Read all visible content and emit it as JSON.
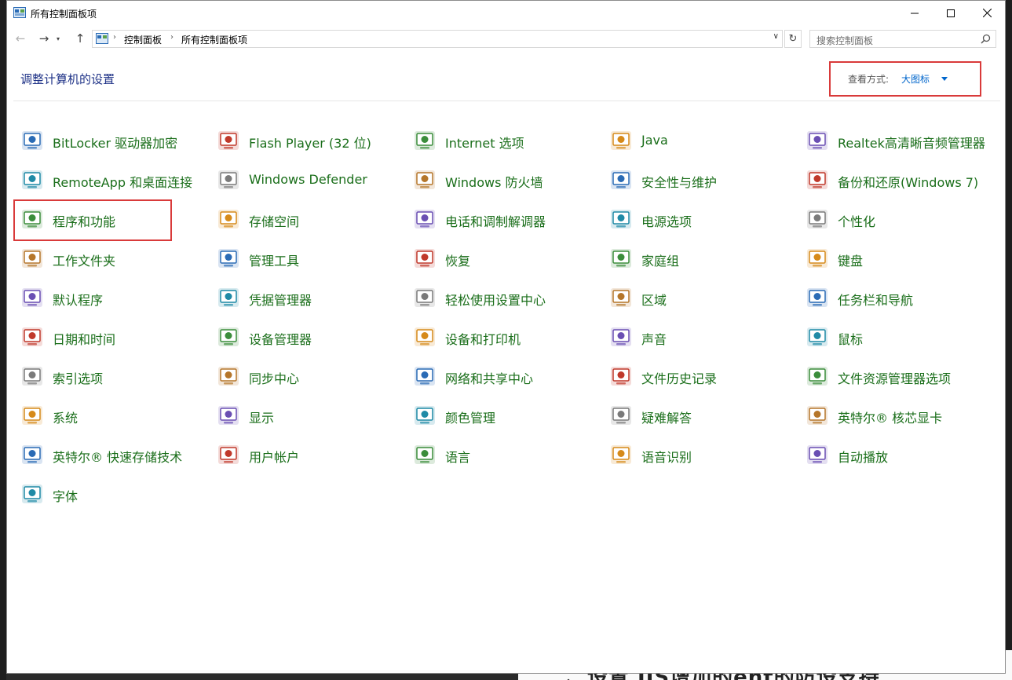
{
  "window": {
    "title": "所有控制面板项"
  },
  "address": {
    "crumbs": [
      "控制面板",
      "所有控制面板项"
    ]
  },
  "search": {
    "placeholder": "搜索控制面板"
  },
  "header": {
    "title": "调整计算机的设置",
    "view_by_label": "查看方式:",
    "view_by_value": "大图标"
  },
  "background_text": "二、设置 IIS增加的ent的防设支持",
  "items": [
    {
      "label": "BitLocker 驱动器加密",
      "icon": "bitlocker-icon"
    },
    {
      "label": "Flash Player (32 位)",
      "icon": "flash-player-icon"
    },
    {
      "label": "Internet 选项",
      "icon": "internet-options-icon"
    },
    {
      "label": "Java",
      "icon": "java-icon"
    },
    {
      "label": "Realtek高清晰音频管理器",
      "icon": "realtek-audio-icon"
    },
    {
      "label": "RemoteApp 和桌面连接",
      "icon": "remoteapp-icon"
    },
    {
      "label": "Windows Defender",
      "icon": "windows-defender-icon"
    },
    {
      "label": "Windows 防火墙",
      "icon": "firewall-icon"
    },
    {
      "label": "安全性与维护",
      "icon": "security-flag-icon"
    },
    {
      "label": "备份和还原(Windows 7)",
      "icon": "backup-restore-icon"
    },
    {
      "label": "程序和功能",
      "icon": "programs-features-icon"
    },
    {
      "label": "存储空间",
      "icon": "storage-spaces-icon"
    },
    {
      "label": "电话和调制解调器",
      "icon": "phone-modem-icon"
    },
    {
      "label": "电源选项",
      "icon": "power-options-icon"
    },
    {
      "label": "个性化",
      "icon": "personalization-icon"
    },
    {
      "label": "工作文件夹",
      "icon": "work-folders-icon"
    },
    {
      "label": "管理工具",
      "icon": "admin-tools-icon"
    },
    {
      "label": "恢复",
      "icon": "recovery-icon"
    },
    {
      "label": "家庭组",
      "icon": "homegroup-icon"
    },
    {
      "label": "键盘",
      "icon": "keyboard-icon"
    },
    {
      "label": "默认程序",
      "icon": "default-programs-icon"
    },
    {
      "label": "凭据管理器",
      "icon": "credential-manager-icon"
    },
    {
      "label": "轻松使用设置中心",
      "icon": "ease-of-access-icon"
    },
    {
      "label": "区域",
      "icon": "region-globe-icon"
    },
    {
      "label": "任务栏和导航",
      "icon": "taskbar-navigation-icon"
    },
    {
      "label": "日期和时间",
      "icon": "date-time-icon"
    },
    {
      "label": "设备管理器",
      "icon": "device-manager-icon"
    },
    {
      "label": "设备和打印机",
      "icon": "devices-printers-icon"
    },
    {
      "label": "声音",
      "icon": "sound-speaker-icon"
    },
    {
      "label": "鼠标",
      "icon": "mouse-icon"
    },
    {
      "label": "索引选项",
      "icon": "indexing-options-icon"
    },
    {
      "label": "同步中心",
      "icon": "sync-center-icon"
    },
    {
      "label": "网络和共享中心",
      "icon": "network-sharing-icon"
    },
    {
      "label": "文件历史记录",
      "icon": "file-history-icon"
    },
    {
      "label": "文件资源管理器选项",
      "icon": "explorer-options-icon"
    },
    {
      "label": "系统",
      "icon": "system-icon"
    },
    {
      "label": "显示",
      "icon": "display-monitor-icon"
    },
    {
      "label": "颜色管理",
      "icon": "color-management-icon"
    },
    {
      "label": "疑难解答",
      "icon": "troubleshooting-icon"
    },
    {
      "label": "英特尔® 核芯显卡",
      "icon": "intel-graphics-icon"
    },
    {
      "label": "英特尔® 快速存储技术",
      "icon": "intel-rapid-storage-icon"
    },
    {
      "label": "用户帐户",
      "icon": "user-accounts-icon"
    },
    {
      "label": "语言",
      "icon": "language-icon"
    },
    {
      "label": "语音识别",
      "icon": "speech-recognition-icon"
    },
    {
      "label": "自动播放",
      "icon": "autoplay-icon"
    },
    {
      "label": "字体",
      "icon": "fonts-icon"
    }
  ]
}
